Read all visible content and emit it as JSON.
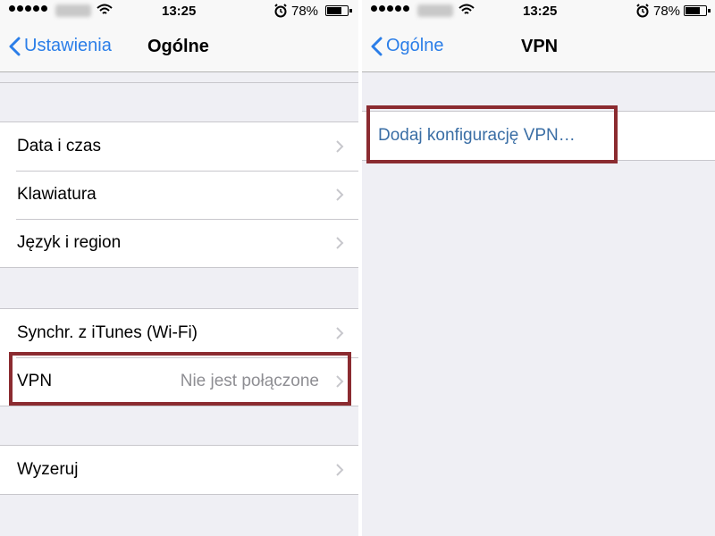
{
  "left": {
    "status": {
      "time": "13:25",
      "battery_pct": "78%",
      "battery_level": 0.78
    },
    "nav": {
      "back_label": "Ustawienia",
      "title": "Ogólne"
    },
    "groups": [
      [
        {
          "label": "Data i czas"
        },
        {
          "label": "Klawiatura"
        },
        {
          "label": "Język i region"
        }
      ],
      [
        {
          "label": "Synchr. z iTunes (Wi-Fi)"
        },
        {
          "label": "VPN",
          "detail": "Nie jest połączone"
        }
      ],
      [
        {
          "label": "Wyzeruj"
        }
      ]
    ]
  },
  "right": {
    "status": {
      "time": "13:25",
      "battery_pct": "78%",
      "battery_level": 0.78
    },
    "nav": {
      "back_label": "Ogólne",
      "title": "VPN"
    },
    "add_vpn_label": "Dodaj konfigurację VPN…"
  },
  "colors": {
    "accent": "#2b7ee8",
    "highlight": "#8b2b30",
    "link_text": "#3a6ea5"
  }
}
